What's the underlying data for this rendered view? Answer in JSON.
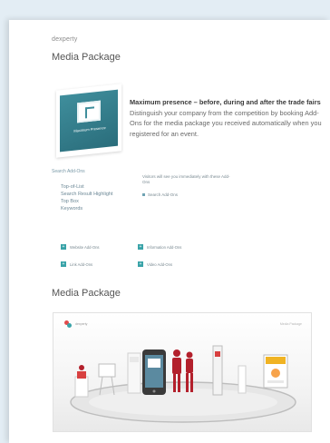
{
  "header": {
    "brand": "dexperty",
    "title": "Media Package"
  },
  "hero": {
    "label": "Maximum Presence",
    "intro_bold": "Maximum presence – before, during and after the trade fairs",
    "intro_text": "Distinguish your company from the competition by booking Add-Ons for the media package you received automatically when you registered for an event."
  },
  "addons": {
    "title": "Search Add-Ons",
    "items": [
      "Top-of-List",
      "Search Result Highlight",
      "Top Box",
      "Keywords"
    ],
    "note": "Visitors will see you immediately with these Add-Ons",
    "search": "Search Add-Ons",
    "chips": [
      "Website Add-Ons",
      "Link Add-Ons",
      "Information Add-Ons",
      "Video Add-Ons"
    ]
  },
  "section2": {
    "title": "Media Package"
  },
  "illustration": {
    "logo_text": "dexperty",
    "caption": "Media Package"
  },
  "colors": {
    "background": "#e3edf4",
    "accent": "#39a3a8",
    "accent_dark": "#2a6d7b",
    "figure_red": "#b3202c"
  }
}
